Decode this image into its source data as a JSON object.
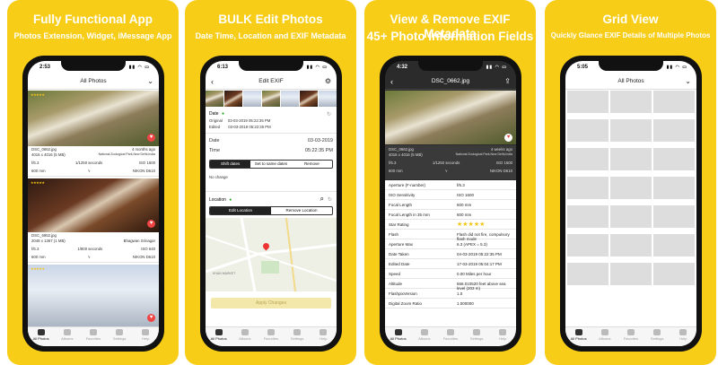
{
  "panels": [
    {
      "headline": "Fully Functional App",
      "subheadline": "Photos Extension, Widget, iMessage App",
      "time": "2:53",
      "nav_title": "All Photos",
      "photos": [
        {
          "name": "DSC_0662.jpg",
          "age": "4 months ago",
          "dims": "4016 x 4016 (5 MB)",
          "location": "National Zoological Park,New Delhi,India",
          "fstop": "f/6.3",
          "shutter": "1/1250 seconds",
          "iso": "ISO 1600",
          "focal": "600 mm",
          "camera": "NIKON D610"
        },
        {
          "name": "DSC_6952.jpg",
          "age": "",
          "dims": "2048 x 1367 (1 MB)",
          "location": "Bhagwan Srinagar",
          "fstop": "f/6.3",
          "shutter": "1/800 seconds",
          "iso": "ISO 640",
          "focal": "600 mm",
          "camera": "NIKON D610"
        }
      ]
    },
    {
      "headline": "BULK Edit Photos",
      "subheadline": "Date Time, Location and EXIF Metadata",
      "time": "6:13",
      "nav_title": "Edit EXIF",
      "date_label": "Date",
      "original_label": "Original",
      "original_value": "03-03-2019 05:22:35 PM",
      "edited_label": "Edited",
      "edited_value": "03-03-2019 05:22:35 PM",
      "date_field_label": "Date",
      "date_field_value": "03-03-2019",
      "time_field_label": "Time",
      "time_field_value": "05:22:35 PM",
      "date_segments": [
        "Shift dates",
        "Set to same dates",
        "Remove"
      ],
      "no_change": "No change",
      "location_label": "Location",
      "location_segments": [
        "Edit Location",
        "Remove Location"
      ],
      "map_label": "KHAN MARKET",
      "apply_label": "Apply Changes"
    },
    {
      "headline": "View & Remove EXIF Metadata",
      "subheadline": "45+ Photo Information Fields",
      "time": "4:32",
      "nav_title": "DSC_0662.jpg",
      "photo": {
        "name": "DSC_0662.jpg",
        "age": "4 weeks ago",
        "dims": "4016 x 4016 (5 MB)",
        "location": "National Zoological Park,New Delhi,India",
        "fstop": "f/6.3",
        "shutter": "1/1250 seconds",
        "iso": "ISO 1600",
        "focal": "600 mm",
        "camera": "NIKON D610"
      },
      "fields": [
        {
          "k": "Aperture (F-number)",
          "v": "f/6.3"
        },
        {
          "k": "ISO Sensitivity",
          "v": "ISO 1600"
        },
        {
          "k": "Focal Length",
          "v": "600 mm"
        },
        {
          "k": "Focal Length in 35 mm",
          "v": "600 mm"
        },
        {
          "k": "Star Rating",
          "v": "★★★★★"
        },
        {
          "k": "Flash",
          "v": "Flash did not fire, compulsory flash mode"
        },
        {
          "k": "Aperture Max",
          "v": "6.3 (APEX = 5.3)"
        },
        {
          "k": "Date Taken",
          "v": "04-03-2019 05:22:35 PM"
        },
        {
          "k": "Edited Date",
          "v": "17-03-2019 05:04:17 PM"
        },
        {
          "k": "Speed",
          "v": "0.00 Miles per hour"
        },
        {
          "k": "Altitude",
          "v": "666.010520 feet above sea level (203 m)"
        },
        {
          "k": "FlashpixVersion",
          "v": "1.0"
        },
        {
          "k": "Digital Zoom Ratio",
          "v": "1.000000"
        }
      ]
    },
    {
      "headline": "Grid View",
      "subheadline": "Quickly Glance EXIF Details of Multiple Photos",
      "time": "5:05",
      "nav_title": "All Photos"
    }
  ],
  "tabbar": [
    "All Photos",
    "Albums",
    "Favorites",
    "Settings",
    "Help"
  ]
}
